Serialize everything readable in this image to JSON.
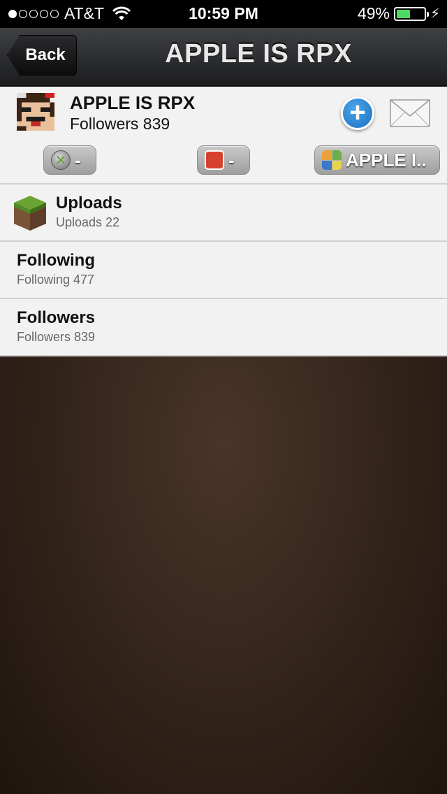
{
  "status_bar": {
    "carrier": "AT&T",
    "time": "10:59 PM",
    "battery": "49%",
    "battery_level": 0.49,
    "signal_bars_filled": 1,
    "signal_bars_total": 5
  },
  "nav": {
    "back_label": "Back",
    "title": "APPLE IS RPX"
  },
  "profile": {
    "name": "APPLE IS RPX",
    "followers": "Followers 839",
    "follow_icon": "plus-icon",
    "message_icon": "envelope-icon",
    "gamertags": [
      {
        "icon": "xbox-icon",
        "label": "-"
      },
      {
        "icon": "game-center-icon",
        "label": "-"
      },
      {
        "icon": "apps-icon",
        "label": "APPLE I.."
      }
    ]
  },
  "list": {
    "items": [
      {
        "title": "Uploads",
        "subtitle": "Uploads 22",
        "icon": "grass-block-icon"
      },
      {
        "title": "Following",
        "subtitle": "Following 477"
      },
      {
        "title": "Followers",
        "subtitle": "Followers 839"
      }
    ]
  },
  "colors": {
    "nav_bg": "#2a2b2d",
    "list_bg": "#f2f2f2",
    "follow_blue": "#2a86d6",
    "page_bg": "#2e2018",
    "battery_green": "#4cd964"
  }
}
